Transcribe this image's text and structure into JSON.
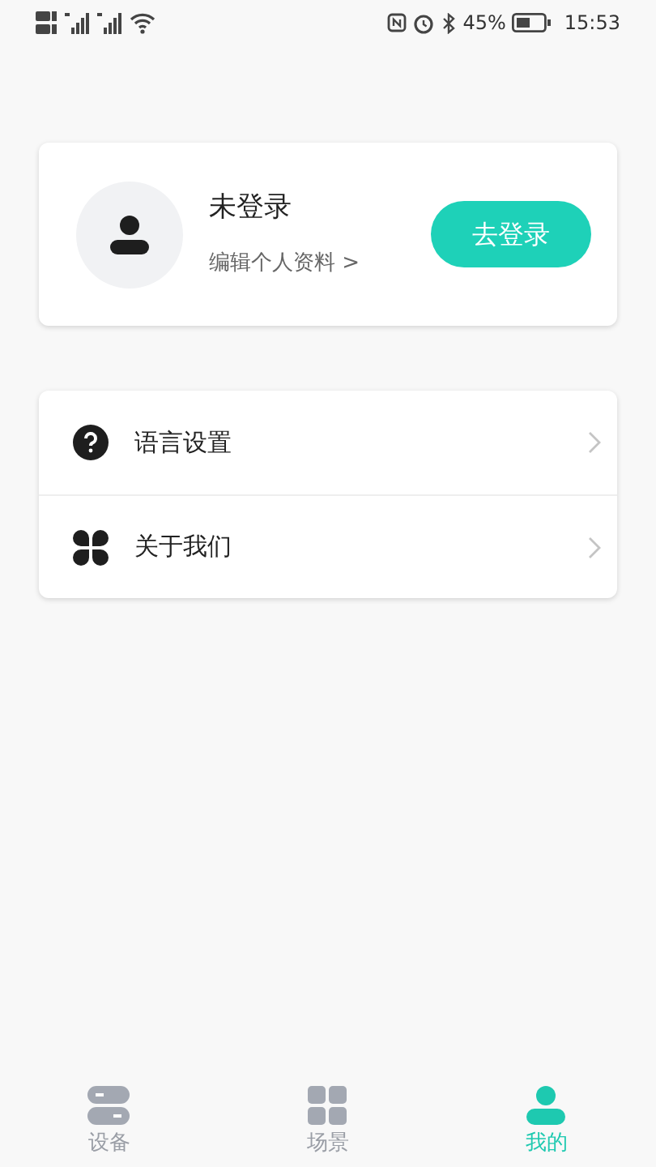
{
  "status_bar": {
    "battery_text": "45%",
    "time": "15:53"
  },
  "profile": {
    "name": "未登录",
    "edit_link": "编辑个人资料",
    "edit_arrow": ">",
    "login_button": "去登录"
  },
  "menu": [
    {
      "kind": "question",
      "label": "语言设置"
    },
    {
      "kind": "clover",
      "label": "关于我们"
    }
  ],
  "tab_bar": [
    {
      "kind": "devices",
      "label": "设备",
      "selected": false
    },
    {
      "kind": "scenes",
      "label": "场景",
      "selected": false
    },
    {
      "kind": "profile",
      "label": "我的",
      "selected": true
    }
  ]
}
